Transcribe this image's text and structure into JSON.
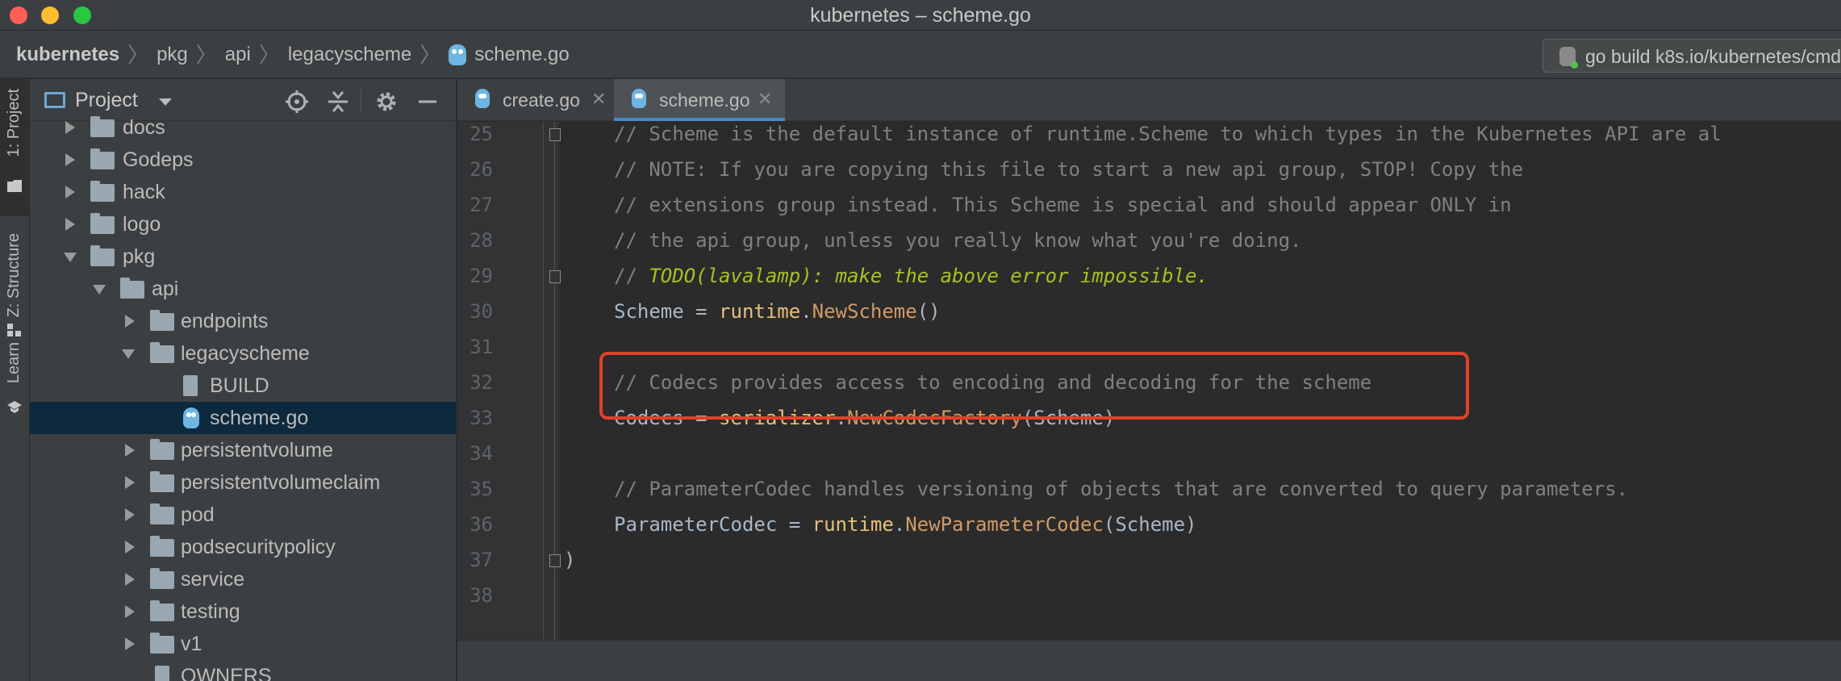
{
  "window": {
    "title": "kubernetes – scheme.go"
  },
  "breadcrumb": {
    "items": [
      "kubernetes",
      "pkg",
      "api",
      "legacyscheme",
      "scheme.go"
    ],
    "separator": "〉"
  },
  "run_config": {
    "label": "go build k8s.io/kubernetes/cmd"
  },
  "tool_stripe": {
    "items": [
      "1: Project",
      "Z: Structure",
      "Learn"
    ]
  },
  "project_panel": {
    "title": "Project",
    "tree": [
      {
        "label": "docs",
        "type": "folder",
        "state": "closed"
      },
      {
        "label": "Godeps",
        "type": "folder",
        "state": "closed"
      },
      {
        "label": "hack",
        "type": "folder",
        "state": "closed"
      },
      {
        "label": "logo",
        "type": "folder",
        "state": "closed"
      },
      {
        "label": "pkg",
        "type": "folder",
        "state": "open"
      },
      {
        "label": "api",
        "type": "folder",
        "state": "open"
      },
      {
        "label": "endpoints",
        "type": "folder",
        "state": "closed"
      },
      {
        "label": "legacyscheme",
        "type": "folder",
        "state": "open"
      },
      {
        "label": "BUILD",
        "type": "file",
        "state": ""
      },
      {
        "label": "scheme.go",
        "type": "go",
        "state": "selected"
      },
      {
        "label": "persistentvolume",
        "type": "folder",
        "state": "closed"
      },
      {
        "label": "persistentvolumeclaim",
        "type": "folder",
        "state": "closed"
      },
      {
        "label": "pod",
        "type": "folder",
        "state": "closed"
      },
      {
        "label": "podsecuritypolicy",
        "type": "folder",
        "state": "closed"
      },
      {
        "label": "service",
        "type": "folder",
        "state": "closed"
      },
      {
        "label": "testing",
        "type": "folder",
        "state": "closed"
      },
      {
        "label": "v1",
        "type": "folder",
        "state": "closed"
      },
      {
        "label": "OWNERS",
        "type": "file",
        "state": ""
      }
    ]
  },
  "tabs": [
    {
      "label": "create.go",
      "active": false
    },
    {
      "label": "scheme.go",
      "active": true
    }
  ],
  "editor": {
    "lines": [
      {
        "num": "25",
        "text": "// Scheme is the default instance of runtime.Scheme to which types in the Kubernetes API are al"
      },
      {
        "num": "26",
        "text": "// NOTE: If you are copying this file to start a new api group, STOP! Copy the"
      },
      {
        "num": "27",
        "text": "// extensions group instead. This Scheme is special and should appear ONLY in"
      },
      {
        "num": "28",
        "text": "// the api group, unless you really know what you're doing."
      },
      {
        "num": "29",
        "prefix": "// ",
        "todo": "TODO(lavalamp): make the above error impossible."
      },
      {
        "num": "30",
        "ident": "Scheme = ",
        "pkg": "runtime",
        "dot": ".",
        "func": "NewScheme",
        "args": "()"
      },
      {
        "num": "31",
        "text": ""
      },
      {
        "num": "32",
        "text": "// Codecs provides access to encoding and decoding for the scheme"
      },
      {
        "num": "33",
        "ident": "Codecs = ",
        "pkg": "serializer",
        "dot": ".",
        "func": "NewCodecFactory",
        "args": "(Scheme)"
      },
      {
        "num": "34",
        "text": ""
      },
      {
        "num": "35",
        "text": "// ParameterCodec handles versioning of objects that are converted to query parameters."
      },
      {
        "num": "36",
        "ident": "ParameterCodec = ",
        "pkg": "runtime",
        "dot": ".",
        "func": "NewParameterCodec",
        "args": "(Scheme)"
      },
      {
        "num": "37",
        "text": ")"
      },
      {
        "num": "38",
        "text": ""
      }
    ]
  },
  "colors": {
    "comment": "#808080",
    "todo": "#a8c023",
    "package": "#e6c07b",
    "function": "#d19a66",
    "identifier": "#a9b7c6",
    "highlight_border": "#e0422a",
    "selection": "#0d293e",
    "tab_underline": "#4a88c7"
  }
}
